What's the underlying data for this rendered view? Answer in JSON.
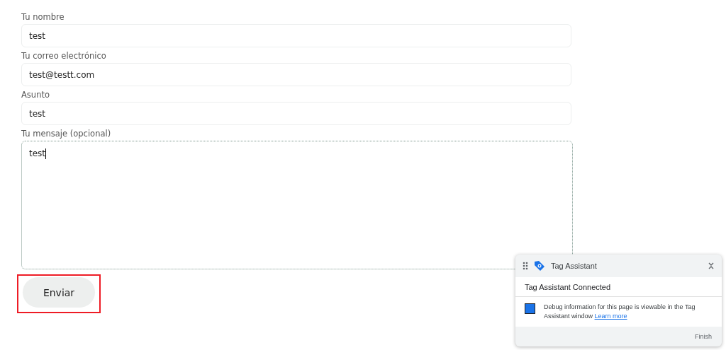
{
  "form": {
    "fields": [
      {
        "label": "Tu nombre",
        "value": "test",
        "kind": "input",
        "focused": false
      },
      {
        "label": "Tu correo electrónico",
        "value": "test@testt.com",
        "kind": "input",
        "focused": false
      },
      {
        "label": "Asunto",
        "value": "test",
        "kind": "input",
        "focused": false
      },
      {
        "label": "Tu mensaje (opcional)",
        "value": "test",
        "kind": "textarea",
        "focused": true
      }
    ],
    "submit": {
      "label": "Enviar",
      "highlighted": true
    }
  },
  "tag_assistant": {
    "title": "Tag Assistant",
    "status": "Tag Assistant Connected",
    "message": "Debug information for this page is viewable in the Tag Assistant window",
    "link": "Learn more",
    "button": "Finish"
  }
}
